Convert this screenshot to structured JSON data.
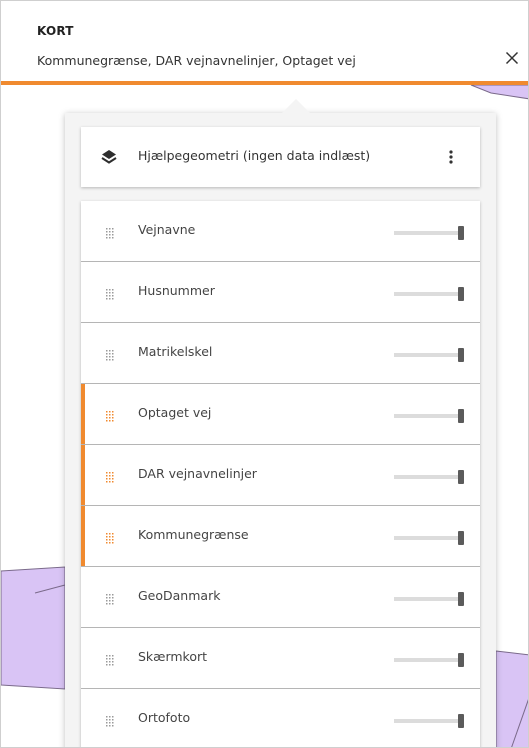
{
  "header": {
    "title": "KORT",
    "subtitle": "Kommunegrænse, DAR vejnavnelinjer, Optaget vej",
    "close_icon": "close-icon"
  },
  "helper": {
    "icon": "layers-icon",
    "label": "Hjælpegeometri (ingen data indlæst)",
    "menu_icon": "more-vertical-icon"
  },
  "colors": {
    "accent": "#f08a2f",
    "map_polygon": "#d9c4f5",
    "map_line": "#7a6a8a"
  },
  "layers": [
    {
      "label": "Vejnavne",
      "active": false,
      "opacity": 1.0
    },
    {
      "label": "Husnummer",
      "active": false,
      "opacity": 1.0
    },
    {
      "label": "Matrikelskel",
      "active": false,
      "opacity": 1.0
    },
    {
      "label": "Optaget vej",
      "active": true,
      "opacity": 1.0
    },
    {
      "label": "DAR vejnavnelinjer",
      "active": true,
      "opacity": 1.0
    },
    {
      "label": "Kommunegrænse",
      "active": true,
      "opacity": 1.0
    },
    {
      "label": "GeoDanmark",
      "active": false,
      "opacity": 1.0
    },
    {
      "label": "Skærmkort",
      "active": false,
      "opacity": 1.0
    },
    {
      "label": "Ortofoto",
      "active": false,
      "opacity": 1.0
    }
  ]
}
